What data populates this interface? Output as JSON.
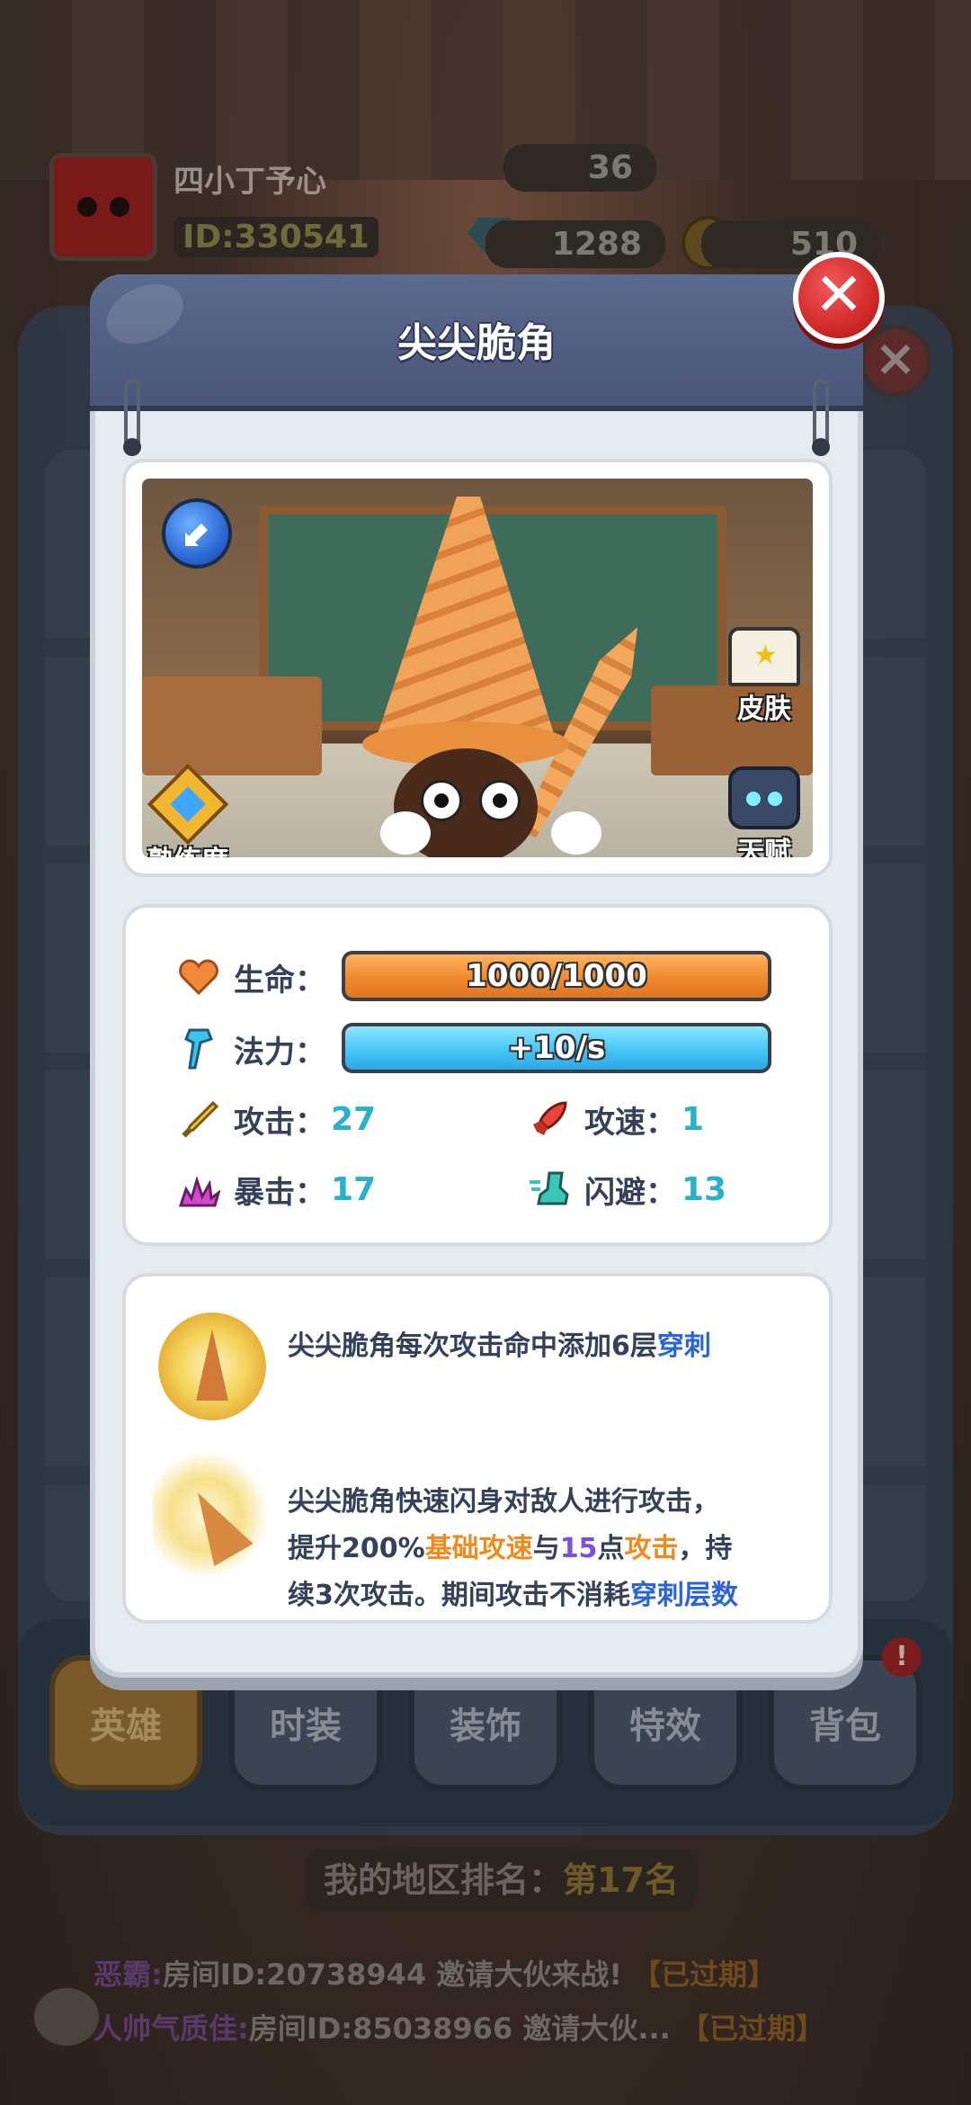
{
  "background": {
    "profile": {
      "nickname": "四小丁予心",
      "user_id": "ID:330541"
    },
    "resources": {
      "level": "36",
      "gems": "1288",
      "coins": "510"
    },
    "tabs": [
      {
        "label": "英雄",
        "active": true
      },
      {
        "label": "时装",
        "active": false
      },
      {
        "label": "装饰",
        "active": false
      },
      {
        "label": "特效",
        "active": false
      },
      {
        "label": "背包",
        "active": false,
        "badge": "!"
      }
    ],
    "rank": {
      "label": "我的地区排名：",
      "value": "第17名"
    },
    "chat": [
      {
        "user": "恶霸:",
        "text": "房间ID:20738944 邀请大伙来战!",
        "status": "【已过期】"
      },
      {
        "user": "人帅气质佳:",
        "text": "房间ID:85038966 邀请大伙...",
        "status": "【已过期】"
      }
    ]
  },
  "modal": {
    "title": "尖尖脆角",
    "close_label": "✕",
    "hero_image": {
      "skill_orb": "⬋",
      "buttons": {
        "skin": "皮肤",
        "talent": "天赋",
        "mastery": "熟练度"
      }
    },
    "stats": {
      "hp": {
        "label": "生命：",
        "value": "1000/1000",
        "fill": 1.0,
        "color": "#f08a2e"
      },
      "mp": {
        "label": "法力：",
        "value": "+10/s",
        "fill": 1.0,
        "color": "#47c5f5"
      },
      "attack": {
        "label": "攻击：",
        "value": "27"
      },
      "attack_speed": {
        "label": "攻速：",
        "value": "1"
      },
      "crit": {
        "label": "暴击：",
        "value": "17"
      },
      "dodge": {
        "label": "闪避：",
        "value": "13"
      }
    },
    "skills": {
      "passive": {
        "prefix": "尖尖脆角每次攻击命中添加6层",
        "keyword": "穿刺"
      },
      "active": {
        "line1": "尖尖脆角快速闪身对敌人进行攻击，",
        "line2_a": "提升200%",
        "line2_b": "基础攻速",
        "line2_c": "与",
        "line2_d": "15",
        "line2_e": "点",
        "line2_f": "攻击",
        "line2_g": "，持",
        "line3_a": "续3次攻击。期间攻击不消耗",
        "line3_b": "穿刺层数"
      }
    }
  }
}
